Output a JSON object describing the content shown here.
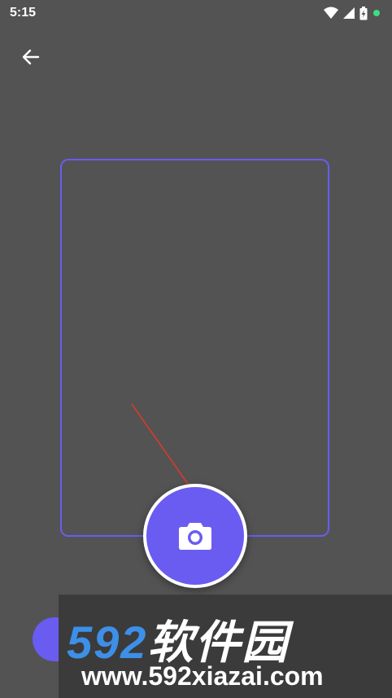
{
  "status_bar": {
    "time": "5:15",
    "icons": [
      "wifi-icon",
      "signal-icon",
      "battery-charging-icon",
      "notification-dot-icon"
    ],
    "dot_color": "#3ddc84"
  },
  "nav": {
    "back_icon": "arrow-left-icon"
  },
  "camera": {
    "shutter_icon": "camera-icon",
    "accent_color": "#6a5cf0"
  },
  "watermark": {
    "brand_digits": "592",
    "brand_name": "软件园",
    "url": "www.592xiazai.com"
  }
}
